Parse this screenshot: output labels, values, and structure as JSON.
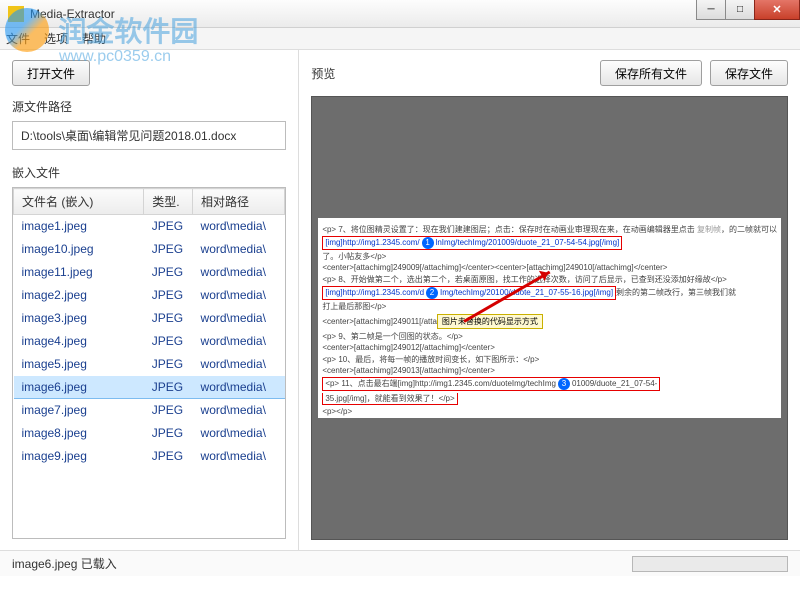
{
  "watermark": {
    "text1": "润金软件园",
    "text2": "www.pc0359.cn"
  },
  "window": {
    "title": "Media-Extractor"
  },
  "menu": {
    "file": "文件",
    "options": "选项",
    "help": "帮助"
  },
  "left": {
    "open_button": "打开文件",
    "source_path_label": "源文件路径",
    "source_path": "D:\\tools\\桌面\\编辑常见问题2018.01.docx",
    "embedded_label": "嵌入文件",
    "columns": {
      "name": "文件名 (嵌入)",
      "type": "类型.",
      "relpath": "相对路径"
    },
    "rows": [
      {
        "name": "image1.jpeg",
        "type": "JPEG",
        "path": "word\\media\\"
      },
      {
        "name": "image10.jpeg",
        "type": "JPEG",
        "path": "word\\media\\"
      },
      {
        "name": "image11.jpeg",
        "type": "JPEG",
        "path": "word\\media\\"
      },
      {
        "name": "image2.jpeg",
        "type": "JPEG",
        "path": "word\\media\\"
      },
      {
        "name": "image3.jpeg",
        "type": "JPEG",
        "path": "word\\media\\"
      },
      {
        "name": "image4.jpeg",
        "type": "JPEG",
        "path": "word\\media\\"
      },
      {
        "name": "image5.jpeg",
        "type": "JPEG",
        "path": "word\\media\\"
      },
      {
        "name": "image6.jpeg",
        "type": "JPEG",
        "path": "word\\media\\",
        "selected": true
      },
      {
        "name": "image7.jpeg",
        "type": "JPEG",
        "path": "word\\media\\"
      },
      {
        "name": "image8.jpeg",
        "type": "JPEG",
        "path": "word\\media\\"
      },
      {
        "name": "image9.jpeg",
        "type": "JPEG",
        "path": "word\\media\\"
      }
    ]
  },
  "right": {
    "preview_label": "预览",
    "save_all": "保存所有文件",
    "save_file": "保存文件",
    "annotation": "图片未替换的代码显示方式",
    "code1": "[img]http://img1.2345.com/",
    "code1b": "lnImg/techImg/201009/duote_21_07-54-54.jpg[/img]",
    "code2": "[img]http://img1.2345.com/d",
    "code2b": "Img/techImg/20100/duote_21_07-55-16.jpg[/img]",
    "code3": "<center>[attachimg]249010[/attachimg]</center>",
    "code4": "<p> 8、开始做第二个，选出第二个，若桌面原图，找工作的选择次数，访问了后显示，已查到还没添加好缘故</p>",
    "code5": "<p> 9、第二帧是一个回图的状态。</p>",
    "code6": "<p> 10、最后，将每一帧的播放时间变长，如下图所示：</p>",
    "code7": "<p> 11、点击最右端[img]http://img1.2345.com/duoteImg/techImg",
    "code7b": "01009/duote_21_07-54-",
    "code8": "35.jpg[/img]，就能看到效果了！</p>",
    "code_generic": "<center>[attachimg]249011[/attachimg]</center>"
  },
  "status": {
    "text": "image6.jpeg 已载入"
  }
}
